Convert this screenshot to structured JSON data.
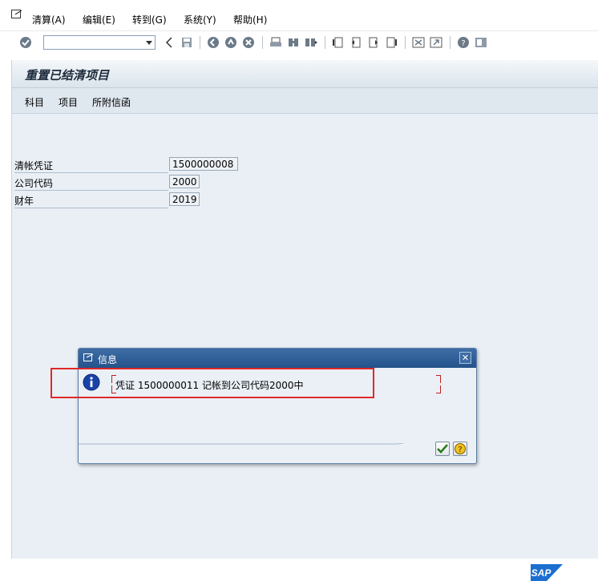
{
  "menubar": {
    "items": [
      {
        "label": "清算(A)"
      },
      {
        "label": "编辑(E)"
      },
      {
        "label": "转到(G)"
      },
      {
        "label": "系统(Y)"
      },
      {
        "label": "帮助(H)"
      }
    ]
  },
  "toolbar": {
    "command_field_value": ""
  },
  "screen": {
    "title": "重置已结清项目",
    "app_buttons": [
      "科目",
      "项目",
      "所附信函"
    ]
  },
  "fields": [
    {
      "label": "清帐凭证",
      "value": "1500000008"
    },
    {
      "label": "公司代码",
      "value": "2000"
    },
    {
      "label": "财年",
      "value": "2019"
    }
  ],
  "dialog": {
    "title": "信息",
    "message": "凭证 1500000011 记帐到公司代码2000中",
    "close_label": "✕"
  },
  "logo": {
    "text": "SAP",
    "color": "#1c6fd1"
  },
  "colors": {
    "dialog_header": "#2f5f98",
    "highlight": "#e02828"
  }
}
